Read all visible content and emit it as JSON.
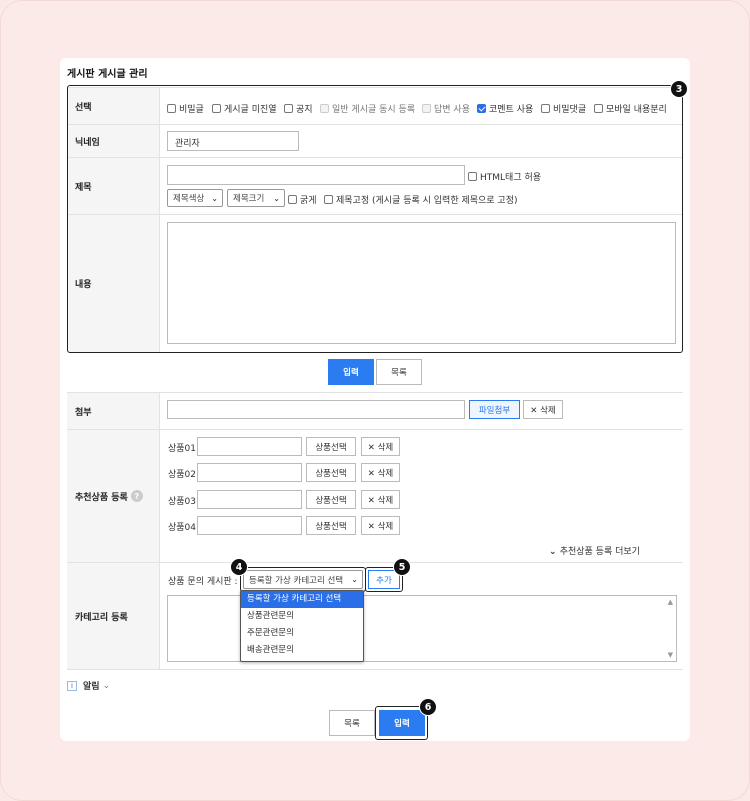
{
  "page": {
    "title": "게시판 게시글 관리"
  },
  "rows": {
    "select": {
      "label": "선택",
      "options": [
        {
          "label": "비밀글",
          "checked": false,
          "disabled": false
        },
        {
          "label": "게시글 미진열",
          "checked": false,
          "disabled": false
        },
        {
          "label": "공지",
          "checked": false,
          "disabled": false
        },
        {
          "label": "일반 게시글 동시 등록",
          "checked": false,
          "disabled": true
        },
        {
          "label": "답변 사용",
          "checked": false,
          "disabled": true
        },
        {
          "label": "코멘트 사용",
          "checked": true,
          "disabled": false
        },
        {
          "label": "비밀댓글",
          "checked": false,
          "disabled": false
        },
        {
          "label": "모바일 내용분리",
          "checked": false,
          "disabled": false
        }
      ]
    },
    "nickname": {
      "label": "닉네임",
      "value": "관리자"
    },
    "subject": {
      "label": "제목",
      "value": "",
      "html_allow": "HTML태그 허용",
      "color_select": "제목색상",
      "size_select": "제목크기",
      "bold": "굵게",
      "fix": "제목고정 (게시글 등록 시 입력한 제목으로 고정)"
    },
    "content": {
      "label": "내용",
      "value": ""
    },
    "attach": {
      "label": "첨부",
      "upload_button": "파일첨부",
      "delete_button": "✕ 삭제"
    },
    "recommend": {
      "label": "추천상품 등록",
      "help": "?",
      "items": [
        {
          "label": "상품01",
          "select_button": "상품선택",
          "delete_button": "✕ 삭제"
        },
        {
          "label": "상품02",
          "select_button": "상품선택",
          "delete_button": "✕ 삭제"
        },
        {
          "label": "상품03",
          "select_button": "상품선택",
          "delete_button": "✕ 삭제"
        },
        {
          "label": "상품04",
          "select_button": "상품선택",
          "delete_button": "✕ 삭제"
        }
      ],
      "more": "추천상품 등록 더보기"
    },
    "category": {
      "label": "카테고리 등록",
      "prefix": "상품 문의 게시판 :",
      "select_value": "등록할 가상 카테고리 선택",
      "add_button": "추가",
      "dropdown": [
        "등록할 가상 카테고리 선택",
        "상품관련문의",
        "주문관련문의",
        "배송관련문의"
      ]
    }
  },
  "mid_buttons": {
    "submit": "입력",
    "list": "목록"
  },
  "notice": {
    "label": "알림",
    "icon": "i"
  },
  "bottom_buttons": {
    "list": "목록",
    "submit": "입력"
  },
  "badges": {
    "b3": "3",
    "b4": "4",
    "b5": "5",
    "b6": "6"
  },
  "colors": {
    "accent": "#2a7cf0",
    "background": "#fbeae7"
  }
}
